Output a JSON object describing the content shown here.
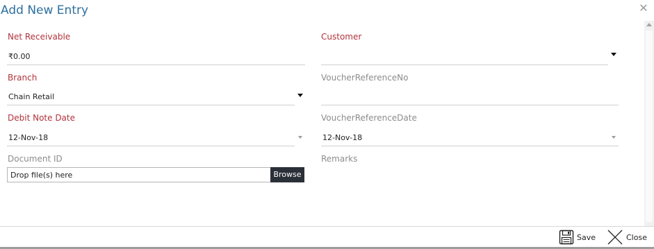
{
  "dialog": {
    "title": "Add New Entry"
  },
  "form": {
    "net_receivable": {
      "label": "Net Receivable",
      "value": "₹0.00"
    },
    "customer": {
      "label": "Customer",
      "value": ""
    },
    "branch": {
      "label": "Branch",
      "value": "Chain Retail"
    },
    "voucher_reference_no": {
      "label": "VoucherReferenceNo",
      "value": ""
    },
    "debit_note_date": {
      "label": "Debit Note Date",
      "value": "12-Nov-18"
    },
    "voucher_reference_date": {
      "label": "VoucherReferenceDate",
      "value": "12-Nov-18"
    },
    "document_id": {
      "label": "Document ID",
      "placeholder": "Drop file(s) here",
      "browse_label": "Browse"
    },
    "remarks": {
      "label": "Remarks"
    }
  },
  "footer": {
    "save_label": "Save",
    "close_label": "Close"
  },
  "icons": {
    "dialog_close": "close-icon",
    "save": "floppy-disk-icon",
    "close": "x-icon",
    "dropdown": "caret-down-icon"
  },
  "colors": {
    "title": "#2e6f9e",
    "required_label": "#b0333b",
    "optional_label": "#8c8c8c",
    "browse_button": "#2b3038"
  }
}
